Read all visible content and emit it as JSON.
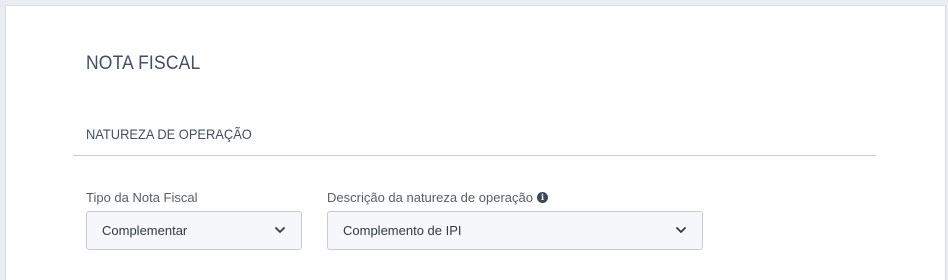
{
  "panel": {
    "title": "NOTA FISCAL",
    "section_title": "NATUREZA DE OPERAÇÃO"
  },
  "fields": {
    "tipo": {
      "label": "Tipo da Nota Fiscal",
      "value": "Complementar",
      "icon": "chevron-down-icon"
    },
    "descricao": {
      "label": "Descrição da natureza de operação",
      "info_icon": "info-icon",
      "value": "Complemento de IPI",
      "icon": "chevron-down-icon"
    }
  },
  "colors": {
    "title": "#3f4f69",
    "label": "#555e6b",
    "select_bg": "#f5f7fa",
    "select_border": "#c6ccd5"
  }
}
